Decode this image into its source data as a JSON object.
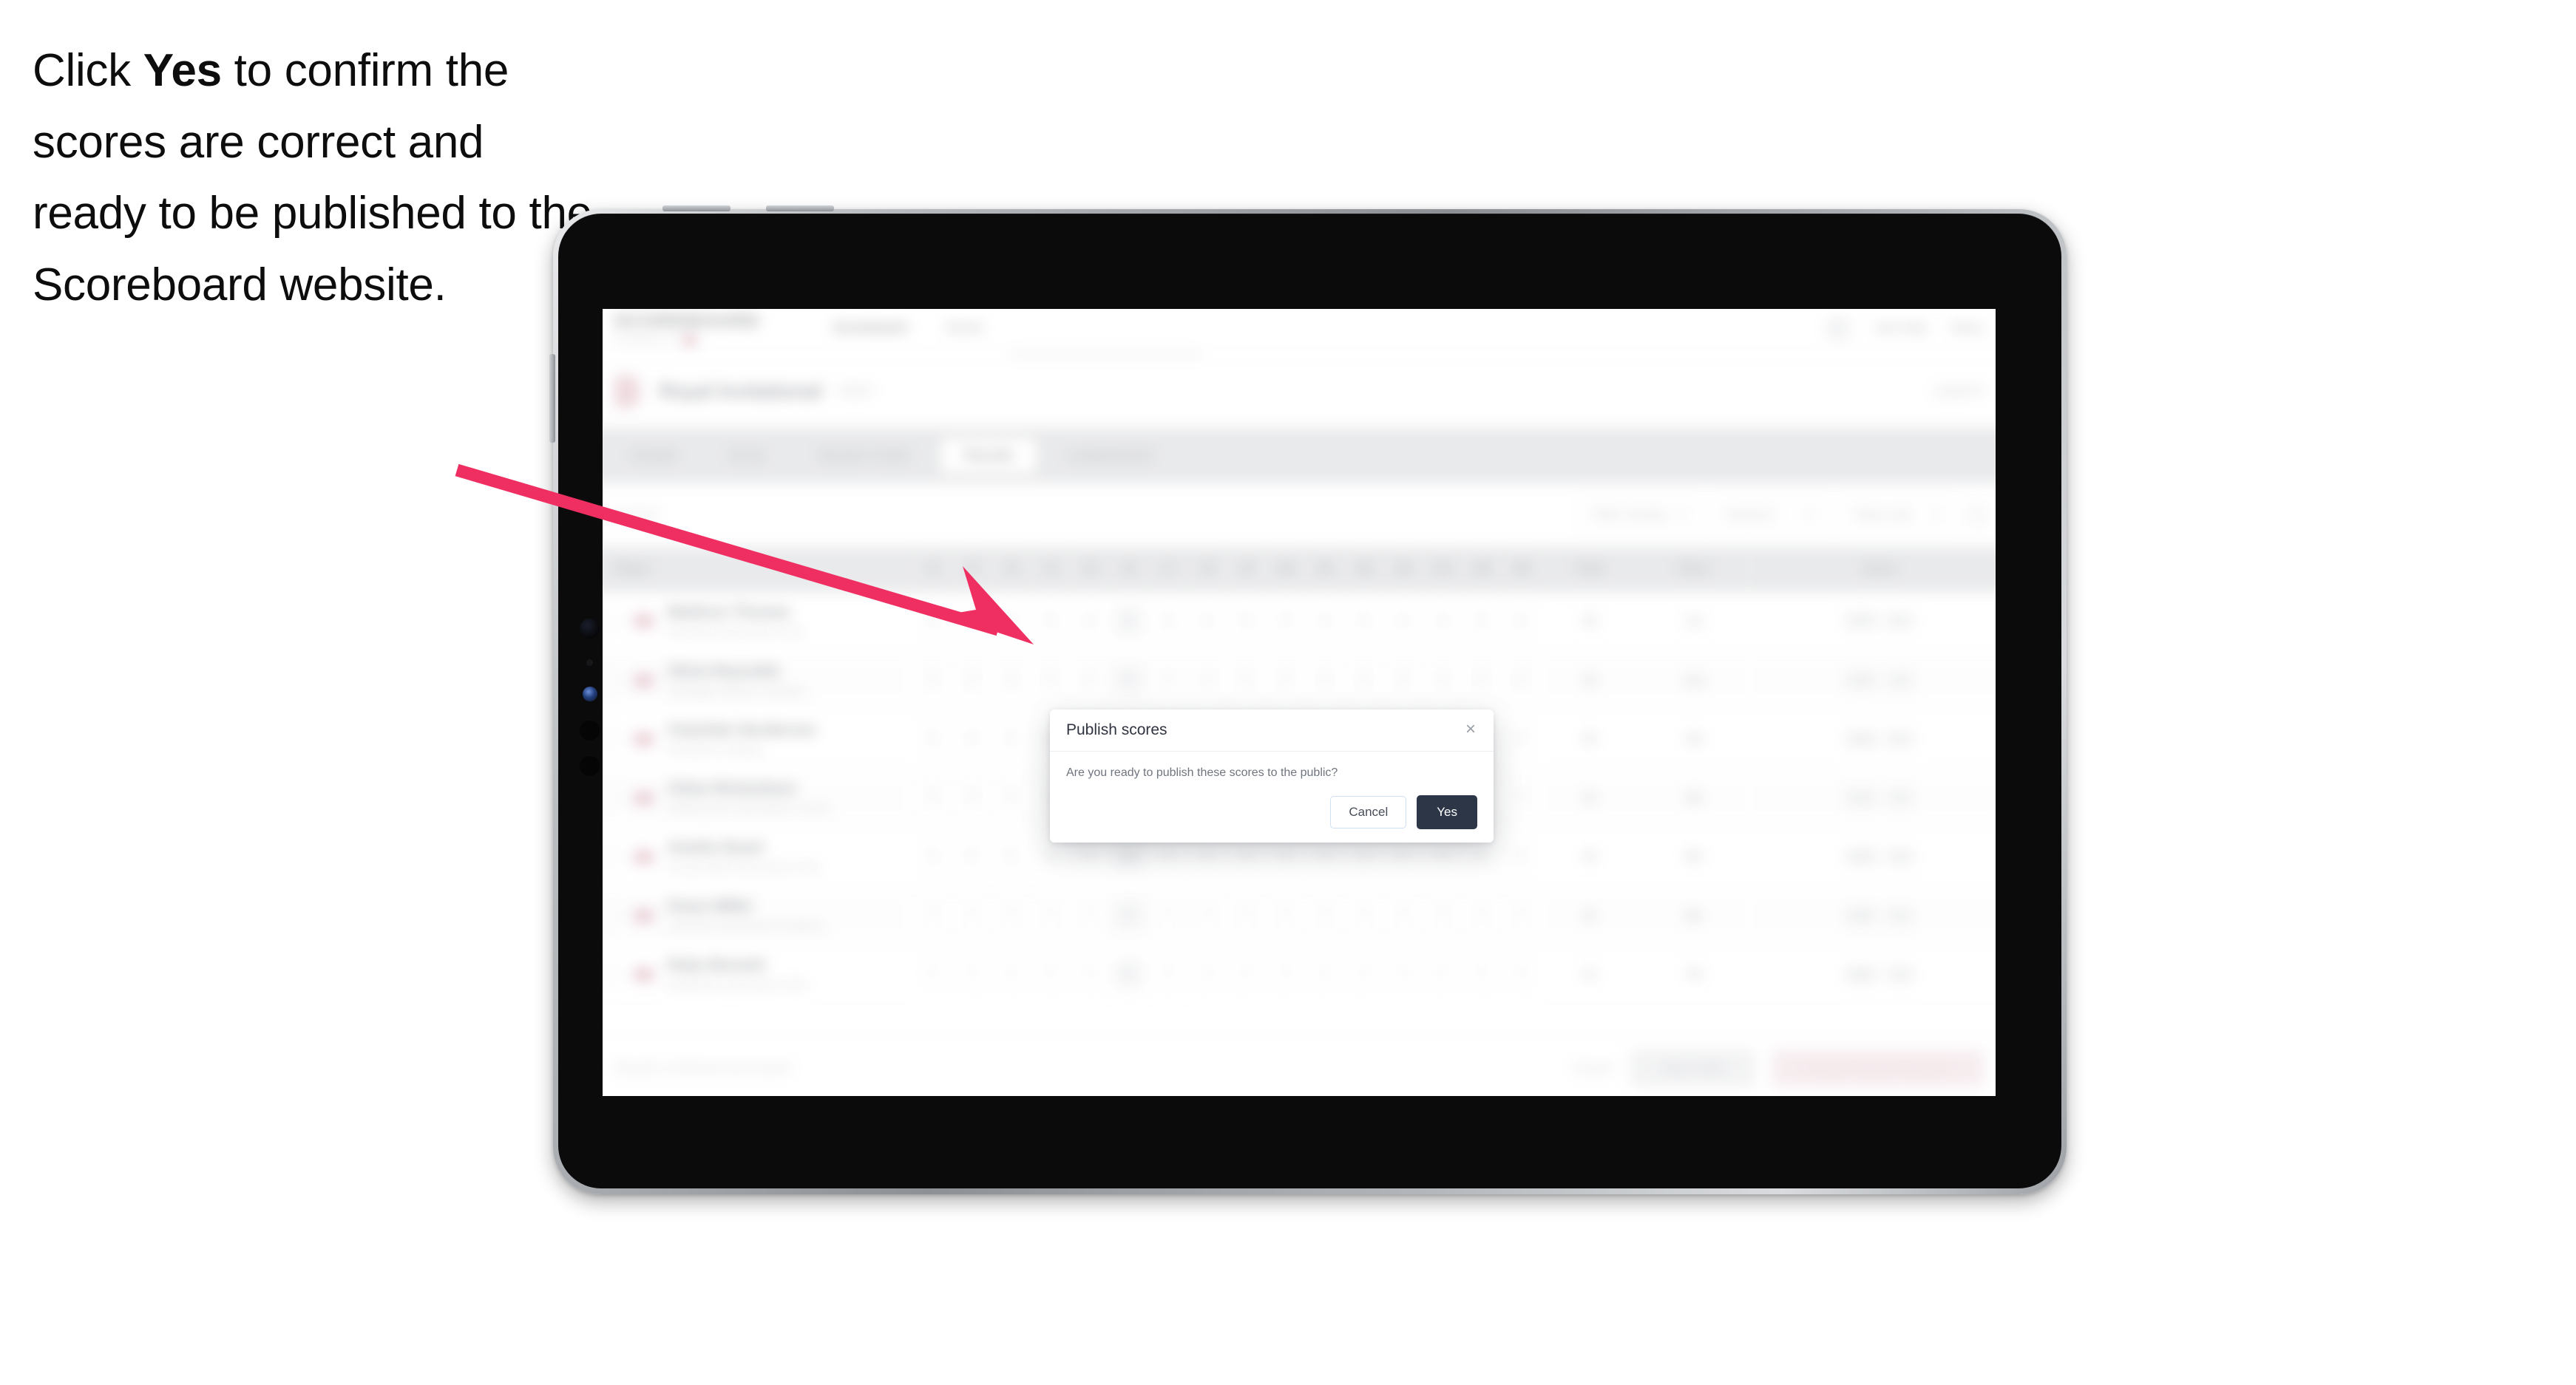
{
  "caption": {
    "before": "Click ",
    "emphasis": "Yes",
    "after": " to confirm the scores are correct and ready to be published to the Scoreboard website."
  },
  "colors": {
    "arrow": "#ef2f62",
    "yes_button_bg": "#2c3647",
    "cancel_border": "#cfe0f2",
    "brand_pink": "#ef3a63",
    "danger_soft": "#fbd8e0"
  },
  "annotation": {
    "arrow_label": "arrow pointing to Yes button"
  },
  "device": {
    "type": "tablet",
    "orientation": "landscape"
  },
  "app": {
    "header": {
      "brand_word": "SCOREBOARD",
      "brand_sub": "POWERED BY",
      "nav": [
        {
          "label": "Scoreboard"
        },
        {
          "label": "Score"
        }
      ],
      "right_items": [
        {
          "label": "Get Help"
        },
        {
          "label": "Menu"
        }
      ]
    },
    "competition": {
      "title": "Royal Invitational",
      "meta": "2024",
      "right_meta": "Level 3"
    },
    "tabs": [
      {
        "label": "Details",
        "active": false
      },
      {
        "label": "Entry",
        "active": false
      },
      {
        "label": "Section Order",
        "active": false
      },
      {
        "label": "Results",
        "active": true
      },
      {
        "label": "Leaderboard",
        "active": false
      }
    ],
    "filters": {
      "left_note": "Section",
      "controls": [
        {
          "label": "Filter Section"
        },
        {
          "label": "Round 2"
        },
        {
          "label": "Team only"
        }
      ]
    },
    "table": {
      "headers": {
        "player": "Player",
        "judge_cols": [
          "J1",
          "J2",
          "J3",
          "J4",
          "J5",
          "J6",
          "J7",
          "J8",
          "J9",
          "J10",
          "J11",
          "J12",
          "J13",
          "J14",
          "J15",
          "J16"
        ],
        "total": "Total",
        "place": "Place",
        "score": "Score"
      },
      "rows": [
        {
          "name": "Madison Thomas",
          "club": "Riverside Gymnastics Club",
          "scores": [
            "9",
            "9",
            "9",
            "9",
            "9",
            "9",
            "9",
            "9",
            "9",
            "9",
            "9",
            "9",
            "9",
            "9",
            "9",
            "9"
          ],
          "total": "36",
          "place": "1st",
          "score": "9.75",
          "bonus": "0.5"
        },
        {
          "name": "Olivia Reynolds",
          "club": "Northgate Athletic Academy",
          "scores": [
            "8",
            "8",
            "8",
            "8",
            "8",
            "8",
            "8",
            "8",
            "8",
            "8",
            "8",
            "8",
            "8",
            "8",
            "8",
            "8"
          ],
          "total": "35",
          "place": "2nd",
          "score": "9.50",
          "bonus": "0.5"
        },
        {
          "name": "Charlotte Henderson",
          "club": "Westfield Tumbling",
          "scores": [
            "8",
            "8",
            "8",
            "8",
            "8",
            "8",
            "8",
            "8",
            "8",
            "8",
            "8",
            "8",
            "8",
            "8",
            "8",
            "8"
          ],
          "total": "34",
          "place": "3rd",
          "score": "9.25",
          "bonus": "0.5"
        },
        {
          "name": "Chloe Richardson",
          "club": "Harbourview Gymnastics Centre",
          "scores": [
            "8",
            "8",
            "8",
            "8",
            "8",
            "9",
            "8",
            "8",
            "8",
            "8",
            "8",
            "8",
            "8",
            "8",
            "8",
            "8"
          ],
          "total": "34",
          "place": "4th",
          "score": "9.10",
          "bonus": "0.5"
        },
        {
          "name": "Amelia Stuart",
          "club": "Summerfield Gymnastics Club",
          "scores": [
            "8",
            "8",
            "8",
            "8",
            "8",
            "9",
            "8",
            "8",
            "8",
            "8",
            "8",
            "8",
            "8",
            "8",
            "8",
            "8"
          ],
          "total": "33",
          "place": "5th",
          "score": "9.00",
          "bonus": "0.5"
        },
        {
          "name": "Grace Miller",
          "club": "Lakeside Gymnastics Academy",
          "scores": [
            "7",
            "7",
            "7",
            "7",
            "7",
            "8",
            "7",
            "7",
            "7",
            "7",
            "7",
            "7",
            "7",
            "7",
            "7",
            "7"
          ],
          "total": "32",
          "place": "6th",
          "score": "8.80",
          "bonus": "0.5"
        },
        {
          "name": "Ruby Bennett",
          "club": "Eastbrook Gymnastics Club",
          "scores": [
            "7",
            "7",
            "7",
            "7",
            "7",
            "8",
            "7",
            "7",
            "7",
            "7",
            "7",
            "7",
            "7",
            "7",
            "7",
            "7"
          ],
          "total": "31",
          "place": "7th",
          "score": "8.60",
          "bonus": "0.5"
        }
      ]
    },
    "footer": {
      "status": "Results confirmed and saved",
      "link": "Export",
      "secondary_button": "Save draft",
      "primary_button": "Publish scores to public"
    }
  },
  "modal": {
    "title": "Publish scores",
    "message": "Are you ready to publish these scores to the public?",
    "close_icon": "×",
    "cancel_label": "Cancel",
    "confirm_label": "Yes"
  }
}
